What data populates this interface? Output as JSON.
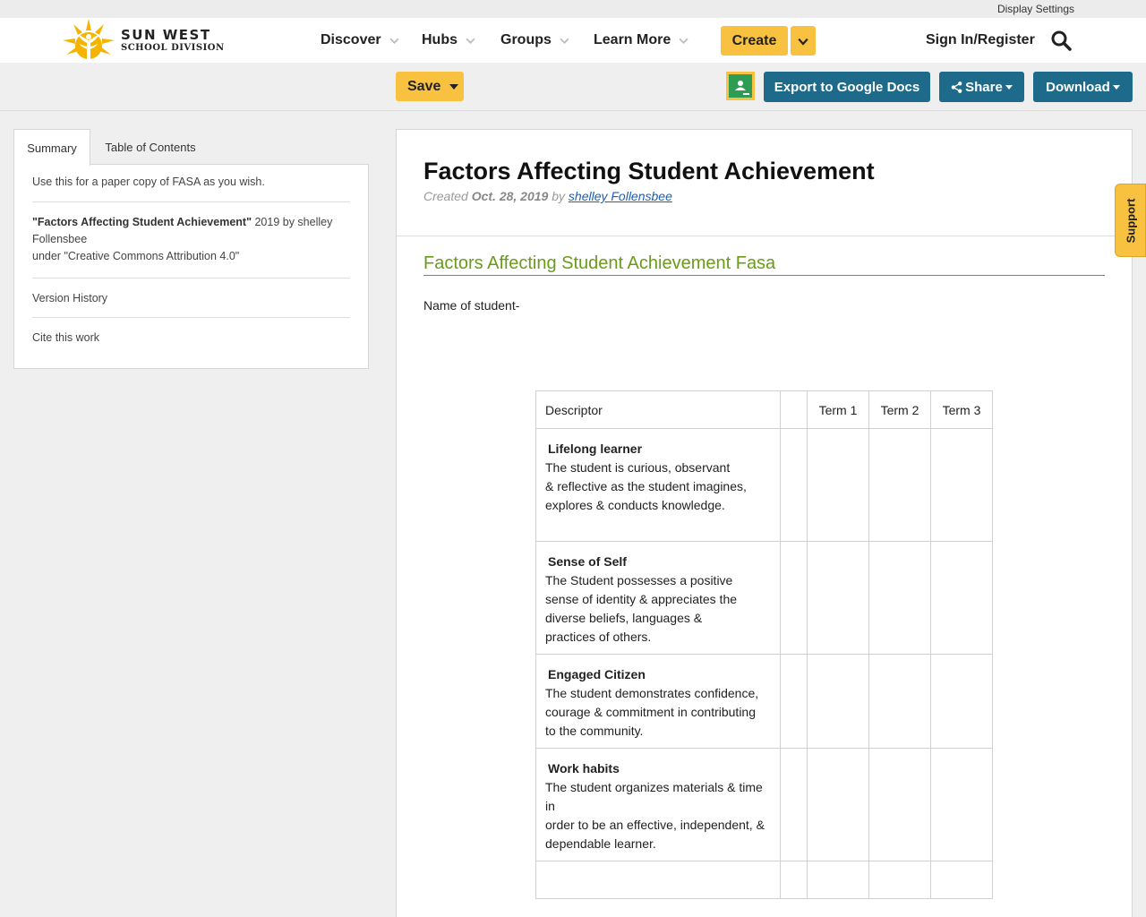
{
  "utility": {
    "display_settings": "Display Settings"
  },
  "logo": {
    "line1": "SUN WEST",
    "line2": "SCHOOL DIVISION"
  },
  "nav": {
    "items": [
      {
        "label": "Discover"
      },
      {
        "label": "Hubs"
      },
      {
        "label": "Groups"
      },
      {
        "label": "Learn More"
      }
    ],
    "create_label": "Create",
    "signin_label": "Sign In/Register",
    "search_icon": "search-icon"
  },
  "toolbar": {
    "save_label": "Save",
    "classroom_icon": "google-classroom-icon",
    "export_label": "Export to Google Docs",
    "share_label": "Share",
    "download_label": "Download"
  },
  "sidebar": {
    "tabs": [
      {
        "label": "Summary",
        "active": true
      },
      {
        "label": "Table of Contents",
        "active": false
      }
    ],
    "description": "Use this for a paper copy of FASA as you wish.",
    "attribution": {
      "work_title": "\"Factors Affecting Student Achievement\"",
      "year_author": " 2019 by shelley Follensbee",
      "license": "under \"Creative Commons Attribution 4.0\""
    },
    "version_history": "Version History",
    "cite": "Cite this work"
  },
  "document": {
    "title": "Factors Affecting Student Achievement",
    "meta": {
      "created_prefix": "Created ",
      "date": "Oct. 28, 2019",
      "by": " by ",
      "author": "shelley Follensbee"
    },
    "section_title": "Factors Affecting Student Achievement  Fasa",
    "student_label": "Name of student-",
    "table": {
      "headers": [
        "Descriptor",
        "",
        "Term 1",
        "Term 2",
        "Term 3"
      ],
      "rows": [
        {
          "title": "Lifelong learner",
          "body": "The student is curious, observant\n& reflective as the student imagines,\nexplores & conducts knowledge."
        },
        {
          "title": "Sense of Self",
          "body": "The Student possesses a positive\nsense of identity & appreciates the\ndiverse beliefs, languages &\npractices of others."
        },
        {
          "title": "Engaged Citizen",
          "body": "The student demonstrates confidence,\ncourage & commitment in contributing\nto the  community."
        },
        {
          "title": "Work habits",
          "body": "The student organizes materials & time in\norder to be an effective, independent, &\ndependable learner."
        }
      ]
    }
  },
  "support": {
    "label": "Support"
  },
  "colors": {
    "accent_yellow": "#f8c13f",
    "button_blue": "#1e6a8a",
    "section_green": "#6a9b1a",
    "link_blue": "#1a5fb4"
  }
}
